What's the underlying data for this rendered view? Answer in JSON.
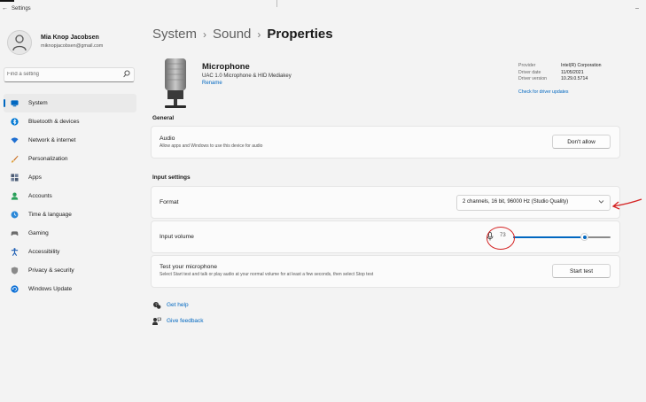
{
  "window": {
    "title": "Settings"
  },
  "profile": {
    "name": "Mia Knop Jacobsen",
    "email": "miknopjacobsen@gmail.com"
  },
  "search": {
    "placeholder": "Find a setting"
  },
  "sidebar": {
    "items": [
      {
        "label": "System",
        "icon": "monitor-icon",
        "color": "#0067c0",
        "active": true
      },
      {
        "label": "Bluetooth & devices",
        "icon": "bluetooth-icon",
        "color": "#0078d4"
      },
      {
        "label": "Network & internet",
        "icon": "wifi-icon",
        "color": "#1f6fd1"
      },
      {
        "label": "Personalization",
        "icon": "brush-icon",
        "color": "#d67a1e"
      },
      {
        "label": "Apps",
        "icon": "apps-icon",
        "color": "#4a5a72"
      },
      {
        "label": "Accounts",
        "icon": "person-icon",
        "color": "#2aa05a"
      },
      {
        "label": "Time & language",
        "icon": "globe-clock-icon",
        "color": "#2b88d8"
      },
      {
        "label": "Gaming",
        "icon": "gamepad-icon",
        "color": "#6b6b6b"
      },
      {
        "label": "Accessibility",
        "icon": "accessibility-icon",
        "color": "#1e5fb4"
      },
      {
        "label": "Privacy & security",
        "icon": "shield-icon",
        "color": "#7a7a7a"
      },
      {
        "label": "Windows Update",
        "icon": "update-icon",
        "color": "#0b6fd6"
      }
    ]
  },
  "breadcrumb": {
    "items": [
      "System",
      "Sound",
      "Properties"
    ],
    "separator": "›"
  },
  "device": {
    "name": "Microphone",
    "subtitle": "UAC 1.0 Microphone & HID Mediakey",
    "rename_label": "Rename",
    "properties": [
      {
        "key": "Provider",
        "value": "Intel(R) Corporation"
      },
      {
        "key": "Driver date",
        "value": "11/05/2021"
      },
      {
        "key": "Driver version",
        "value": "10.29.0.5714"
      }
    ],
    "check_updates_label": "Check for driver updates"
  },
  "general": {
    "heading": "General",
    "audio": {
      "title": "Audio",
      "subtitle": "Allow apps and Windows to use this device for audio",
      "button": "Don't allow"
    }
  },
  "input_settings": {
    "heading": "Input settings",
    "format": {
      "title": "Format",
      "value": "2 channels, 16 bit, 96000 Hz (Studio Quality)"
    },
    "volume": {
      "title": "Input volume",
      "value": "73",
      "level": 0.73
    },
    "test": {
      "title": "Test your microphone",
      "subtitle": "Select Start test and talk or play audio at your normal volume for at least a few seconds, then select Stop test",
      "button": "Start test"
    }
  },
  "help": {
    "get_help": "Get help",
    "give_feedback": "Give feedback"
  },
  "colors": {
    "accent": "#0067c0",
    "annotation": "#d42222"
  }
}
